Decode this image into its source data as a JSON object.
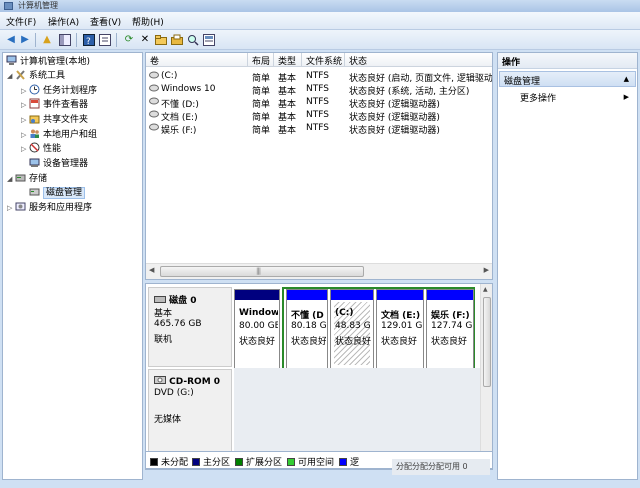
{
  "window": {
    "title": "计算机管理"
  },
  "menu": [
    "文件(F)",
    "操作(A)",
    "查看(V)",
    "帮助(H)"
  ],
  "toolbar_icons": [
    "back-icon",
    "forward-icon",
    "up-folder-icon",
    "show-hide-tree-icon",
    "help-icon",
    "properties-icon",
    "refresh-icon",
    "delete-icon",
    "open-icon",
    "save-icon",
    "search-icon",
    "export-icon"
  ],
  "tree": {
    "root": "计算机管理(本地)",
    "system_tools": "系统工具",
    "task_scheduler": "任务计划程序",
    "event_viewer": "事件查看器",
    "shared_folders": "共享文件夹",
    "local_users": "本地用户和组",
    "performance": "性能",
    "device_manager": "设备管理器",
    "storage": "存储",
    "disk_management": "磁盘管理",
    "services_apps": "服务和应用程序"
  },
  "volume_table": {
    "columns": [
      "卷",
      "布局",
      "类型",
      "文件系统",
      "状态"
    ],
    "rows": [
      [
        "(C:)",
        "简单",
        "基本",
        "NTFS",
        "状态良好 (启动, 页面文件, 逻辑驱动"
      ],
      [
        "Windows 10",
        "简单",
        "基本",
        "NTFS",
        "状态良好 (系统, 活动, 主分区)"
      ],
      [
        "不懂 (D:)",
        "简单",
        "基本",
        "NTFS",
        "状态良好 (逻辑驱动器)"
      ],
      [
        "文档 (E:)",
        "简单",
        "基本",
        "NTFS",
        "状态良好 (逻辑驱动器)"
      ],
      [
        "娱乐 (F:)",
        "简单",
        "基本",
        "NTFS",
        "状态良好 (逻辑驱动器)"
      ]
    ]
  },
  "disk0": {
    "name": "磁盘 0",
    "type": "基本",
    "size": "465.76 GB",
    "status": "联机",
    "partitions": [
      {
        "name": "Window",
        "size": "80.00 GE",
        "status": "状态良好"
      },
      {
        "name": "不懂 (D",
        "size": "80.18 G",
        "status": "状态良好"
      },
      {
        "name": "(C:)",
        "size": "48.83 G",
        "status": "状态良好"
      },
      {
        "name": "文档 (E:)",
        "size": "129.01 G",
        "status": "状态良好"
      },
      {
        "name": "娱乐 (F:)",
        "size": "127.74 G",
        "status": "状态良好"
      }
    ]
  },
  "cdrom": {
    "name": "CD-ROM 0",
    "drive": "DVD (G:)",
    "media": "无媒体"
  },
  "legend": [
    {
      "label": "未分配",
      "color": "#000000"
    },
    {
      "label": "主分区",
      "color": "#00007f"
    },
    {
      "label": "扩展分区",
      "color": "#008000"
    },
    {
      "label": "可用空间",
      "color": "#33cc33"
    },
    {
      "label": "逻",
      "color": "#0000ff"
    }
  ],
  "status_overlay": "分配分配分配可用 0",
  "actions": {
    "header": "操作",
    "selected": "磁盘管理",
    "more": "更多操作"
  },
  "colors": {
    "primary_bar": "#00007f",
    "logical_bar": "#0000ff",
    "extended_border": "#2a8a2a"
  }
}
